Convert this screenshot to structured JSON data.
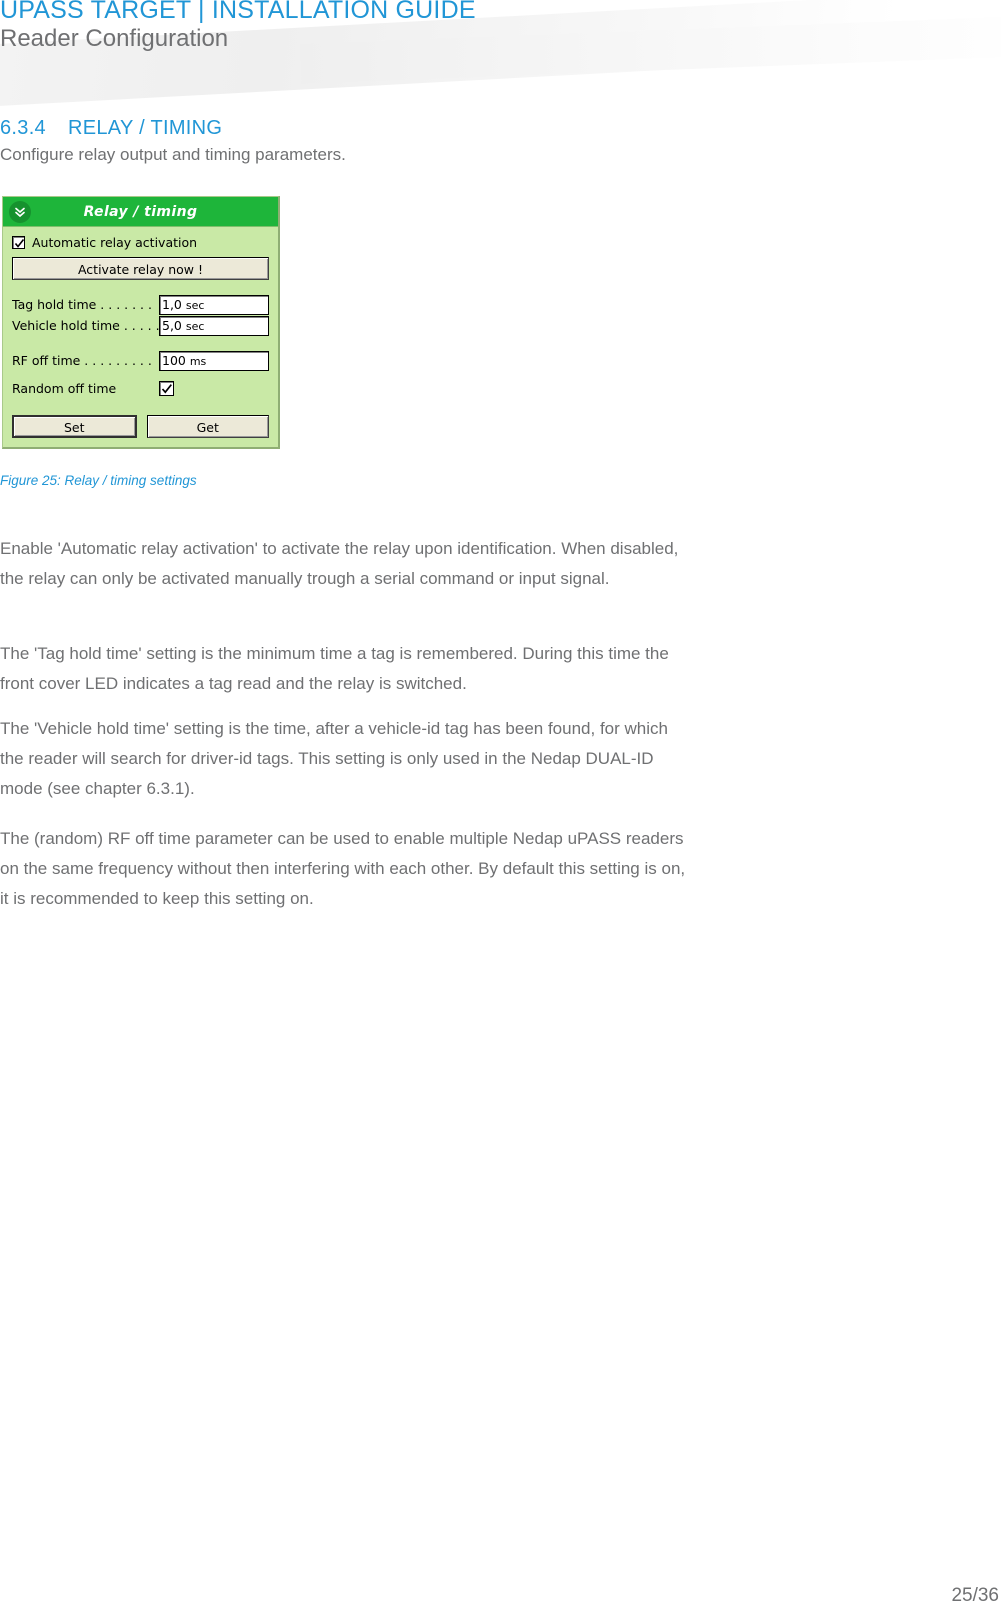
{
  "header": {
    "title": "UPASS TARGET | INSTALLATION GUIDE",
    "subtitle": "Reader Configuration",
    "title_color": "#2196d6",
    "subtitle_color": "#6f7072"
  },
  "section": {
    "number": "6.3.4",
    "title": "RELAY / TIMING",
    "intro": "Configure relay output and timing parameters."
  },
  "figure": {
    "caption": "Figure 25: Relay / timing settings",
    "caption_color": "#2196d6",
    "widget": {
      "titlebar": {
        "label": "Relay / timing",
        "icon": "double-chevron-down-icon",
        "background_color": "#1eb53a",
        "text_color": "#ffffff"
      },
      "panel_background_color": "#c9e9a6",
      "automatic_relay_activation": {
        "label": "Automatic relay activation",
        "checked": true
      },
      "activate_button_label": "Activate relay now !",
      "fields": [
        {
          "label": "Tag hold time . . . . . . .",
          "value": "1,0",
          "unit": "sec"
        },
        {
          "label": "Vehicle hold time . . . . .",
          "value": "5,0",
          "unit": "sec"
        },
        {
          "label": "RF off time . . . . . . . . .",
          "value": "100",
          "unit": "ms"
        }
      ],
      "random_off_time": {
        "label": "Random off time",
        "checked": true
      },
      "set_button_label": "Set",
      "get_button_label": "Get"
    }
  },
  "body": {
    "paragraph_1": "Enable 'Automatic relay activation' to activate the relay upon identification. When disabled, the relay can only be activated manually trough a serial command or input signal.",
    "paragraph_2": "The 'Tag hold time' setting is the minimum time a tag is remembered. During this time the front cover LED indicates a tag read and the relay is switched.",
    "paragraph_3": "The 'Vehicle hold time' setting is the time, after a vehicle-id tag has been found, for which the reader will search for driver-id tags. This setting is only used in the Nedap DUAL-ID mode (see chapter 6.3.1).",
    "paragraph_4": "The (random) RF off time parameter can be used to enable multiple Nedap uPASS readers on the same frequency without then interfering with each other. By default this setting is on, it is recommended to keep this setting on."
  },
  "footer": {
    "page_number": "25/36"
  }
}
